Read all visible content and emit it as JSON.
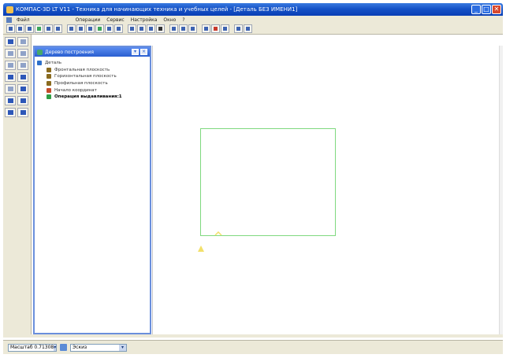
{
  "window": {
    "title": "КОМПАС-3D LT V11 - Техника для начинающих техника и учебных целей - [Деталь БЕЗ ИМЕНИ1]",
    "controls": {
      "minimize": "_",
      "maximize": "□",
      "close": "✕"
    }
  },
  "menu": {
    "items": [
      "Файл",
      "",
      "Операции",
      "Сервис",
      "Настройка",
      "Окно",
      "?"
    ]
  },
  "tree": {
    "title": "Дерево построения",
    "nodes": [
      {
        "label": "Деталь",
        "indent": 0,
        "icon_color": "#2d6fc9",
        "bold": false
      },
      {
        "label": "Фронтальная плоскость",
        "indent": 1,
        "icon_color": "#8a6b1f",
        "bold": false
      },
      {
        "label": "Горизонтальная плоскость",
        "indent": 1,
        "icon_color": "#8a6b1f",
        "bold": false
      },
      {
        "label": "Профильная плоскость",
        "indent": 1,
        "icon_color": "#8a6b1f",
        "bold": false
      },
      {
        "label": "Начало координат",
        "indent": 1,
        "icon_color": "#c44b2a",
        "bold": false
      },
      {
        "label": "Операция выдавливания:1",
        "indent": 1,
        "icon_color": "#2f9e44",
        "bold": true
      }
    ]
  },
  "status": {
    "scale": "Масштаб 0.71308",
    "view": "Эскиз"
  },
  "colors": {
    "titlebar": "#1552c7",
    "sketch_line": "#7fd97f",
    "origin_marker": "#f2e06a",
    "panel_border": "#6a8fdc"
  }
}
